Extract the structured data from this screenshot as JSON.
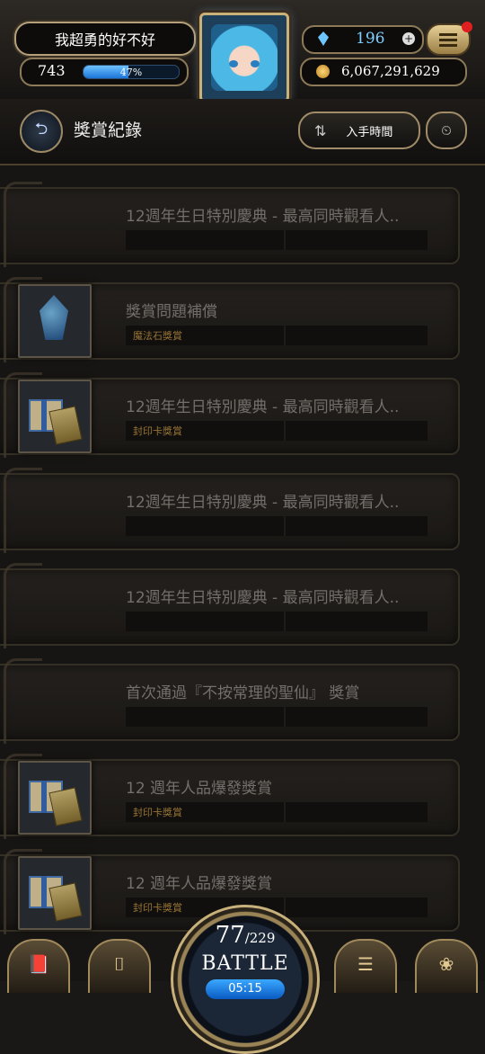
{
  "player": {
    "name": "我超勇的好不好",
    "level": "743",
    "exp_percent": "47%",
    "exp_fraction": 0.47,
    "gems": "196",
    "coins": "6,067,291,629"
  },
  "header": {
    "title": "獎賞紀錄",
    "sort_label": "入手時間"
  },
  "rewards": [
    {
      "title": "12週年生日特別慶典 - 最高同時觀看人..",
      "subtitle": "",
      "thumb": "none"
    },
    {
      "title": "獎賞問題補償",
      "subtitle": "魔法石獎賞",
      "thumb": "magic-stone"
    },
    {
      "title": "12週年生日特別慶典 - 最高同時觀看人..",
      "subtitle": "封印卡獎賞",
      "thumb": "seal-card"
    },
    {
      "title": "12週年生日特別慶典 - 最高同時觀看人..",
      "subtitle": "",
      "thumb": "none"
    },
    {
      "title": "12週年生日特別慶典 - 最高同時觀看人..",
      "subtitle": "",
      "thumb": "none"
    },
    {
      "title": "首次通過『不按常理的聖仙』 獎賞",
      "subtitle": "",
      "thumb": "none"
    },
    {
      "title": "12 週年人品爆發獎賞",
      "subtitle": "封印卡獎賞",
      "thumb": "seal-card"
    },
    {
      "title": "12 週年人品爆發獎賞",
      "subtitle": "封印卡獎賞",
      "thumb": "seal-card"
    }
  ],
  "battle": {
    "stamina_current": "77",
    "stamina_max": "/229",
    "label": "BATTLE",
    "timer": "05:15"
  },
  "colors": {
    "accent_gold": "#c9b178",
    "exp_blue": "#1c74d8",
    "subtitle_gold": "#b58a40"
  }
}
